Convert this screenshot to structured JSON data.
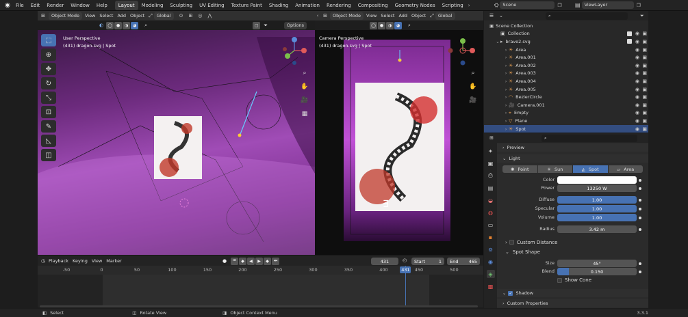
{
  "topbar": {
    "menus": [
      "File",
      "Edit",
      "Render",
      "Window",
      "Help"
    ],
    "workspaces": [
      "Layout",
      "Modeling",
      "Sculpting",
      "UV Editing",
      "Texture Paint",
      "Shading",
      "Animation",
      "Rendering",
      "Compositing",
      "Geometry Nodes",
      "Scripting"
    ],
    "active_workspace": "Layout",
    "scene": "Scene",
    "view_layer": "ViewLayer"
  },
  "viewport_left": {
    "mode": "Object Mode",
    "menus": [
      "View",
      "Select",
      "Add",
      "Object"
    ],
    "transform": "Global",
    "options": "Options",
    "info_title": "User Perspective",
    "info_sub": "(431) dragon.svg | Spot"
  },
  "viewport_right": {
    "mode": "Object Mode",
    "menus": [
      "View",
      "Select",
      "Add",
      "Object"
    ],
    "transform": "Global",
    "info_title": "Camera Perspective",
    "info_sub": "(431) dragon.svg | Spot"
  },
  "timeline": {
    "menus": [
      "Playback",
      "Keying",
      "View",
      "Marker"
    ],
    "current_frame": "431",
    "start_label": "Start",
    "start": "1",
    "end_label": "End",
    "end": "465",
    "ticks": [
      "-50",
      "0",
      "50",
      "100",
      "150",
      "200",
      "250",
      "300",
      "350",
      "400",
      "450",
      "500"
    ],
    "tick_values": [
      -50,
      0,
      50,
      100,
      150,
      200,
      250,
      300,
      350,
      400,
      450,
      500
    ],
    "playhead_frame": 431,
    "playhead_label": "431"
  },
  "outliner": {
    "root": "Scene Collection",
    "items": [
      {
        "label": "Collection",
        "depth": 0
      },
      {
        "label": "brave2.svg",
        "depth": 0
      },
      {
        "label": "Area",
        "depth": 1
      },
      {
        "label": "Area.001",
        "depth": 1
      },
      {
        "label": "Area.002",
        "depth": 1
      },
      {
        "label": "Area.003",
        "depth": 1
      },
      {
        "label": "Area.004",
        "depth": 1
      },
      {
        "label": "Area.005",
        "depth": 1
      },
      {
        "label": "BezierCircle",
        "depth": 1
      },
      {
        "label": "Camera.001",
        "depth": 1
      },
      {
        "label": "Empty",
        "depth": 1
      },
      {
        "label": "Plane",
        "depth": 1
      },
      {
        "label": "Spot",
        "depth": 1
      }
    ]
  },
  "properties": {
    "preview": "Preview",
    "light": "Light",
    "light_types": [
      "Point",
      "Sun",
      "Spot",
      "Area"
    ],
    "active_type": "Spot",
    "color_label": "Color",
    "color": "#ffffff",
    "power_label": "Power",
    "power": "13250 W",
    "diffuse_label": "Diffuse",
    "diffuse": "1.00",
    "specular_label": "Specular",
    "specular": "1.00",
    "volume_label": "Volume",
    "volume": "1.00",
    "radius_label": "Radius",
    "radius": "3.42 m",
    "custom_distance": "Custom Distance",
    "spot_shape": "Spot Shape",
    "size_label": "Size",
    "size": "45°",
    "blend_label": "Blend",
    "blend": "0.150",
    "blend_fraction": 0.15,
    "show_cone": "Show Cone",
    "shadow": "Shadow",
    "custom_properties": "Custom Properties"
  },
  "status": {
    "select": "Select",
    "rotate": "Rotate View",
    "context": "Object Context Menu",
    "version": "3.3.1"
  },
  "colors": {
    "accent": "#4772b3",
    "purple": "#8a2a9c",
    "bg": "#1d1d1d"
  }
}
